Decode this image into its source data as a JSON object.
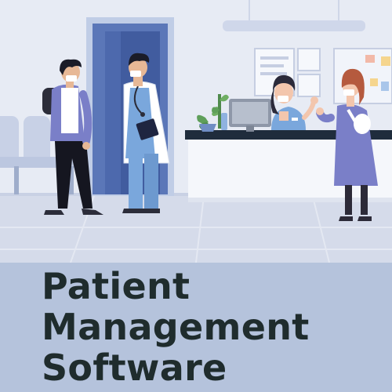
{
  "title": {
    "line1": "Patient",
    "line2": "Management",
    "line3": "Software"
  },
  "colors": {
    "wall": "#e6eaf4",
    "floor": "#d6dcea",
    "caption_background": "#b5c3dc",
    "title_text": "#1f2c2d",
    "doorway_blue": "#5b77b8",
    "scrubs_blue": "#7aa7dc",
    "counter_top": "#1f2c3c",
    "purple_jacket": "#7a7fc8"
  },
  "icons": [
    "waiting-chairs-icon",
    "door-icon",
    "student-icon",
    "doctor-icon",
    "reception-desk-icon",
    "receptionist-icon",
    "computer-monitor-icon",
    "potted-plant-icon",
    "notice-board-icon",
    "visitor-icon"
  ]
}
